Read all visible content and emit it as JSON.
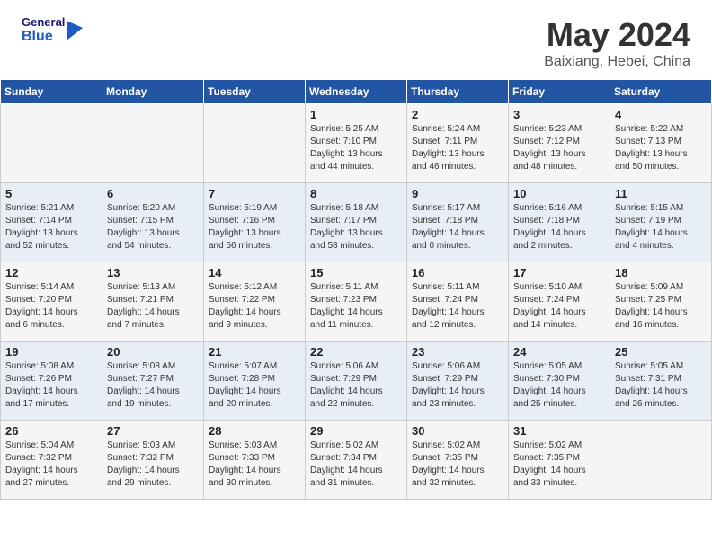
{
  "header": {
    "logo_general": "General",
    "logo_blue": "Blue",
    "month_title": "May 2024",
    "location": "Baixiang, Hebei, China"
  },
  "weekdays": [
    "Sunday",
    "Monday",
    "Tuesday",
    "Wednesday",
    "Thursday",
    "Friday",
    "Saturday"
  ],
  "weeks": [
    [
      {
        "day": "",
        "info": ""
      },
      {
        "day": "",
        "info": ""
      },
      {
        "day": "",
        "info": ""
      },
      {
        "day": "1",
        "info": "Sunrise: 5:25 AM\nSunset: 7:10 PM\nDaylight: 13 hours\nand 44 minutes."
      },
      {
        "day": "2",
        "info": "Sunrise: 5:24 AM\nSunset: 7:11 PM\nDaylight: 13 hours\nand 46 minutes."
      },
      {
        "day": "3",
        "info": "Sunrise: 5:23 AM\nSunset: 7:12 PM\nDaylight: 13 hours\nand 48 minutes."
      },
      {
        "day": "4",
        "info": "Sunrise: 5:22 AM\nSunset: 7:13 PM\nDaylight: 13 hours\nand 50 minutes."
      }
    ],
    [
      {
        "day": "5",
        "info": "Sunrise: 5:21 AM\nSunset: 7:14 PM\nDaylight: 13 hours\nand 52 minutes."
      },
      {
        "day": "6",
        "info": "Sunrise: 5:20 AM\nSunset: 7:15 PM\nDaylight: 13 hours\nand 54 minutes."
      },
      {
        "day": "7",
        "info": "Sunrise: 5:19 AM\nSunset: 7:16 PM\nDaylight: 13 hours\nand 56 minutes."
      },
      {
        "day": "8",
        "info": "Sunrise: 5:18 AM\nSunset: 7:17 PM\nDaylight: 13 hours\nand 58 minutes."
      },
      {
        "day": "9",
        "info": "Sunrise: 5:17 AM\nSunset: 7:18 PM\nDaylight: 14 hours\nand 0 minutes."
      },
      {
        "day": "10",
        "info": "Sunrise: 5:16 AM\nSunset: 7:18 PM\nDaylight: 14 hours\nand 2 minutes."
      },
      {
        "day": "11",
        "info": "Sunrise: 5:15 AM\nSunset: 7:19 PM\nDaylight: 14 hours\nand 4 minutes."
      }
    ],
    [
      {
        "day": "12",
        "info": "Sunrise: 5:14 AM\nSunset: 7:20 PM\nDaylight: 14 hours\nand 6 minutes."
      },
      {
        "day": "13",
        "info": "Sunrise: 5:13 AM\nSunset: 7:21 PM\nDaylight: 14 hours\nand 7 minutes."
      },
      {
        "day": "14",
        "info": "Sunrise: 5:12 AM\nSunset: 7:22 PM\nDaylight: 14 hours\nand 9 minutes."
      },
      {
        "day": "15",
        "info": "Sunrise: 5:11 AM\nSunset: 7:23 PM\nDaylight: 14 hours\nand 11 minutes."
      },
      {
        "day": "16",
        "info": "Sunrise: 5:11 AM\nSunset: 7:24 PM\nDaylight: 14 hours\nand 12 minutes."
      },
      {
        "day": "17",
        "info": "Sunrise: 5:10 AM\nSunset: 7:24 PM\nDaylight: 14 hours\nand 14 minutes."
      },
      {
        "day": "18",
        "info": "Sunrise: 5:09 AM\nSunset: 7:25 PM\nDaylight: 14 hours\nand 16 minutes."
      }
    ],
    [
      {
        "day": "19",
        "info": "Sunrise: 5:08 AM\nSunset: 7:26 PM\nDaylight: 14 hours\nand 17 minutes."
      },
      {
        "day": "20",
        "info": "Sunrise: 5:08 AM\nSunset: 7:27 PM\nDaylight: 14 hours\nand 19 minutes."
      },
      {
        "day": "21",
        "info": "Sunrise: 5:07 AM\nSunset: 7:28 PM\nDaylight: 14 hours\nand 20 minutes."
      },
      {
        "day": "22",
        "info": "Sunrise: 5:06 AM\nSunset: 7:29 PM\nDaylight: 14 hours\nand 22 minutes."
      },
      {
        "day": "23",
        "info": "Sunrise: 5:06 AM\nSunset: 7:29 PM\nDaylight: 14 hours\nand 23 minutes."
      },
      {
        "day": "24",
        "info": "Sunrise: 5:05 AM\nSunset: 7:30 PM\nDaylight: 14 hours\nand 25 minutes."
      },
      {
        "day": "25",
        "info": "Sunrise: 5:05 AM\nSunset: 7:31 PM\nDaylight: 14 hours\nand 26 minutes."
      }
    ],
    [
      {
        "day": "26",
        "info": "Sunrise: 5:04 AM\nSunset: 7:32 PM\nDaylight: 14 hours\nand 27 minutes."
      },
      {
        "day": "27",
        "info": "Sunrise: 5:03 AM\nSunset: 7:32 PM\nDaylight: 14 hours\nand 29 minutes."
      },
      {
        "day": "28",
        "info": "Sunrise: 5:03 AM\nSunset: 7:33 PM\nDaylight: 14 hours\nand 30 minutes."
      },
      {
        "day": "29",
        "info": "Sunrise: 5:02 AM\nSunset: 7:34 PM\nDaylight: 14 hours\nand 31 minutes."
      },
      {
        "day": "30",
        "info": "Sunrise: 5:02 AM\nSunset: 7:35 PM\nDaylight: 14 hours\nand 32 minutes."
      },
      {
        "day": "31",
        "info": "Sunrise: 5:02 AM\nSunset: 7:35 PM\nDaylight: 14 hours\nand 33 minutes."
      },
      {
        "day": "",
        "info": ""
      }
    ]
  ]
}
